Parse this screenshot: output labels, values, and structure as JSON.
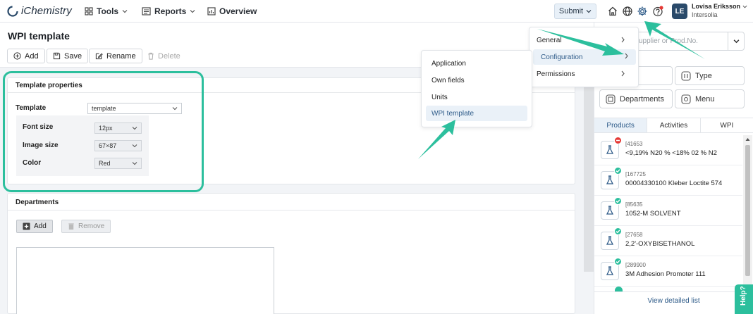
{
  "app": {
    "name": "iChemistry"
  },
  "nav": {
    "tools": "Tools",
    "reports": "Reports",
    "overview": "Overview"
  },
  "topbar": {
    "submit": "Submit"
  },
  "user": {
    "name": "Lovisa Eriksson",
    "org": "Intersolia",
    "initials": "LE"
  },
  "page": {
    "title": "WPI template"
  },
  "toolbar": {
    "add": "Add",
    "save": "Save",
    "rename": "Rename",
    "delete": "Delete"
  },
  "template_props": {
    "title": "Template properties",
    "template_label": "Template",
    "template_value": "template",
    "font_label": "Font size",
    "font_value": "12px",
    "image_label": "Image size",
    "image_value": "67×87",
    "color_label": "Color",
    "color_value": "Red"
  },
  "departments": {
    "title": "Departments",
    "add": "Add",
    "remove": "Remove"
  },
  "settings_menu": {
    "general": "General",
    "configuration": "Configuration",
    "permissions": "Permissions"
  },
  "config_menu": {
    "application": "Application",
    "own_fields": "Own fields",
    "units": "Units",
    "wpi_template": "WPI template"
  },
  "right_panel": {
    "search_placeholder": "supplier or Prod.No.",
    "type_btn": "Type",
    "departments_btn": "Departments",
    "menu_btn": "Menu",
    "tabs": [
      "Products",
      "Activities",
      "WPI"
    ],
    "items": [
      {
        "code": "[41653",
        "name": "<9,19% N20 % <18% 02 % N2",
        "status": "error"
      },
      {
        "code": "[167725",
        "name": "00004330100 Kleber Loctite 574",
        "status": "ok"
      },
      {
        "code": "[85635",
        "name": "1052-M SOLVENT",
        "status": "ok"
      },
      {
        "code": "[27658",
        "name": "2,2'-OXYBISETHANOL",
        "status": "ok"
      },
      {
        "code": "[289900",
        "name": "3M Adhesion Promoter 111",
        "status": "ok"
      }
    ],
    "view_list": "View detailed list",
    "help": "Help?"
  },
  "colors": {
    "accent": "#2cbf9d",
    "error": "#e53935",
    "ok": "#2cbf9d",
    "brand": "#2a4a6a"
  }
}
